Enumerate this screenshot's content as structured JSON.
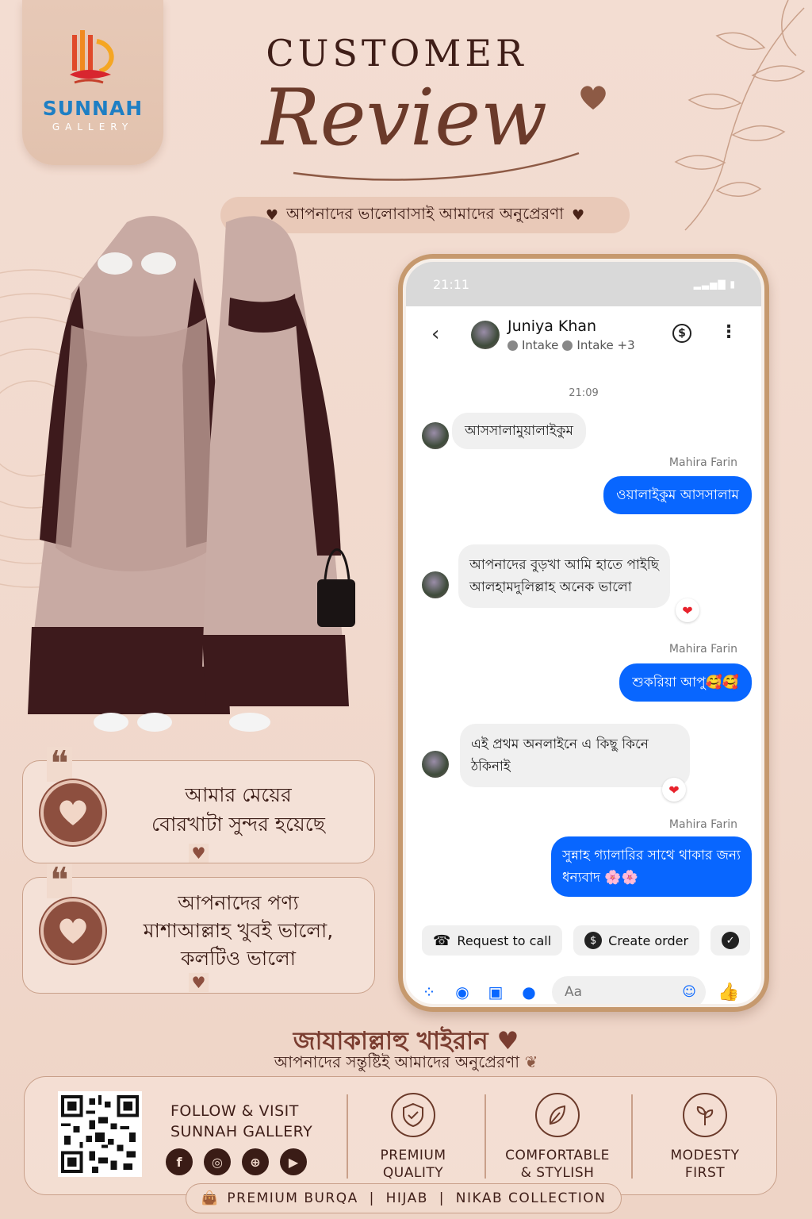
{
  "brand": {
    "name": "SUNNAH",
    "sub": "GALLERY"
  },
  "header": {
    "line1": "CUSTOMER",
    "line2": "Review",
    "tagline": "আপনাদের ভালোবাসাই আমাদের অনুপ্রেরণা"
  },
  "reviews": [
    {
      "line1": "আমার মেয়ের",
      "line2": "বোরখাটা সুন্দর হয়েছে"
    },
    {
      "line1": "আপনাদের পণ্য",
      "line2": "মাশাআল্লাহ খুবই ভালো,",
      "line3": "কলটিও ভালো"
    }
  ],
  "phone": {
    "status_time": "21:11",
    "contact_name": "Juniya Khan",
    "contact_sub1": "Intake",
    "contact_sub2": "Intake +3",
    "timestamp": "21:09",
    "messages": {
      "m1": "আসসালামুয়ালাইকুম",
      "sender": "Mahira Farin",
      "m2": "ওয়ালাইকুম আসসালাম",
      "m3_line1": "আপনাদের বুড়খা আমি হাতে পাইছি",
      "m3_line2": "আলহামদুলিল্লাহ অনেক ভালো",
      "m4": "শুকরিয়া আপু🥰🥰",
      "m5_line1": "এই প্রথম অনলাইনে এ কিছু কিনে",
      "m5_line2": "ঠকিনাই",
      "m6_line1": "সুন্নাহ গ্যালারির সাথে থাকার জন্য",
      "m6_line2": "ধন্যবাদ 🌸🌸"
    },
    "quick_actions": [
      "Request to call",
      "Create order"
    ],
    "composer_placeholder": "Aa"
  },
  "closing": {
    "title": "জাযাকাল্লাহু খাইরান",
    "subtitle": "আপনাদের সন্তুষ্টিই আমাদের অনুপ্রেরণা"
  },
  "footer": {
    "follow_line1": "FOLLOW & VISIT",
    "follow_line2": "SUNNAH GALLERY",
    "features": [
      {
        "line1": "PREMIUM",
        "line2": "QUALITY",
        "icon": "shield-check-icon"
      },
      {
        "line1": "COMFORTABLE",
        "line2": "& STYLISH",
        "icon": "feather-icon"
      },
      {
        "line1": "MODESTY",
        "line2": "FIRST",
        "icon": "plant-icon"
      }
    ],
    "collection": "PREMIUM BURQA  |  HIJAB  |  NIKAB COLLECTION"
  },
  "colors": {
    "background": "#f1d9cd",
    "brown": "#6b3a2a",
    "messenger_blue": "#0866ff",
    "brand_blue": "#1e7fc4"
  }
}
